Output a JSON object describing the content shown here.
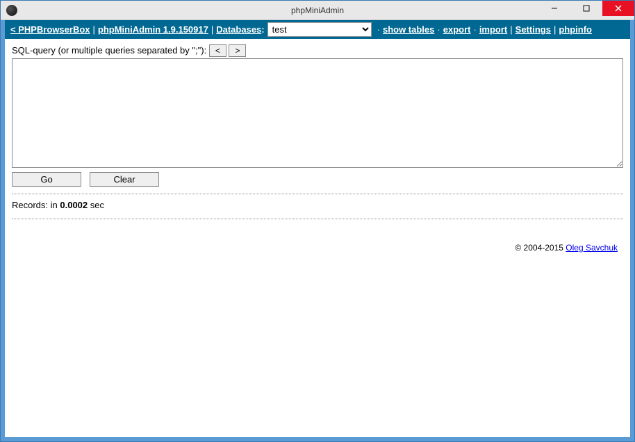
{
  "window": {
    "title": "phpMiniAdmin"
  },
  "topbar": {
    "back_label": "< PHPBrowserBox",
    "app_label": "phpMiniAdmin 1.9.150917",
    "databases_label": "Databases",
    "db_selected": "test",
    "show_tables": "show tables",
    "export": "export",
    "import": "import",
    "settings": "Settings",
    "phpinfo": "phpinfo"
  },
  "query": {
    "label": "SQL-query (or multiple queries separated by \";\"):",
    "prev": "<",
    "next": ">",
    "value": "",
    "go": "Go",
    "clear": "Clear"
  },
  "records": {
    "prefix": "Records:  in ",
    "time": "0.0002",
    "suffix": " sec"
  },
  "footer": {
    "copyright": "© 2004-2015 ",
    "author": "Oleg Savchuk"
  }
}
